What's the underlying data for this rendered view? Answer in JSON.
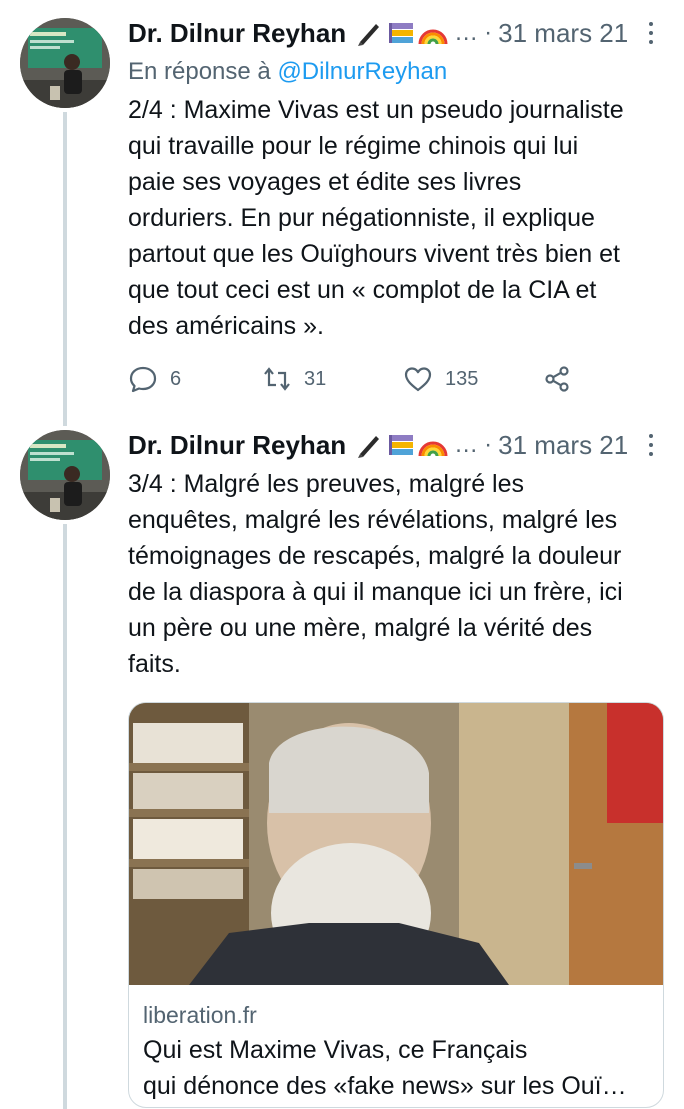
{
  "tweets": [
    {
      "author_name": "Dr. Dilnur Reyhan",
      "badges": [
        "pen-icon",
        "books-icon",
        "rainbow-icon"
      ],
      "ellipsis": "…",
      "separator": "·",
      "date": "31 mars 21",
      "reply_prefix": "En réponse à ",
      "reply_handle": "@DilnurReyhan",
      "text": "2/4 : Maxime Vivas est un pseudo journaliste\nqui travaille pour le régime chinois qui lui\npaie ses voyages et édite ses livres\norduriers. En pur négationniste, il explique\npartout que les Ouïghours vivent très bien et\nque tout ceci est un « complot de la CIA et\ndes américains ».",
      "reply_count": "6",
      "retweet_count": "31",
      "like_count": "135"
    },
    {
      "author_name": "Dr. Dilnur Reyhan",
      "badges": [
        "pen-icon",
        "books-icon",
        "rainbow-icon"
      ],
      "ellipsis": "…",
      "separator": "·",
      "date": "31 mars 21",
      "text": "3/4 : Malgré les preuves, malgré les\nenquêtes, malgré les révélations, malgré les\ntémoignages de rescapés, malgré la douleur\nde la diaspora à qui il manque ici un frère, ici\nun père ou une mère, malgré la vérité des\nfaits.",
      "card": {
        "domain": "liberation.fr",
        "title_line1": "Qui est Maxime Vivas, ce Français",
        "title_line2": "qui dénonce des «fake news» sur les Ouï…"
      }
    }
  ],
  "colors": {
    "text": "#0f1419",
    "secondary": "#536471",
    "link": "#1d9bf0",
    "border": "#cfd9de"
  }
}
